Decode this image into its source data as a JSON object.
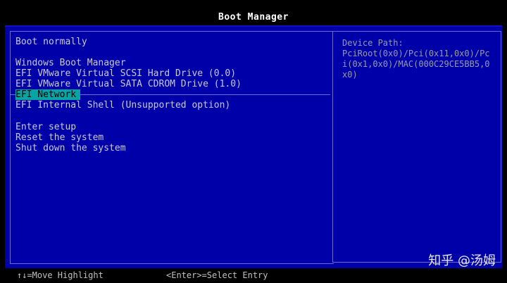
{
  "header": {
    "title": "Boot Manager"
  },
  "menu": {
    "items": [
      {
        "label": "Boot normally"
      },
      {
        "label": "Windows Boot Manager"
      },
      {
        "label": "EFI VMware Virtual SCSI Hard Drive (0.0)"
      },
      {
        "label": "EFI VMware Virtual SATA CDROM Drive (1.0)"
      },
      {
        "label": "EFI Network",
        "selected": true
      },
      {
        "label": "EFI Internal Shell (Unsupported option)"
      },
      {
        "label": "Enter setup"
      },
      {
        "label": "Reset the system"
      },
      {
        "label": "Shut down the system"
      }
    ]
  },
  "info": {
    "label": "Device Path:",
    "value": "PciRoot(0x0)/Pci(0x11,0x0)/Pci(0x1,0x0)/MAC(000C29CE5BB5,0x0)"
  },
  "footer": {
    "move_hint": "↑↓=Move Highlight",
    "select_hint": "<Enter>=Select Entry"
  },
  "watermark": {
    "text": "知乎 @汤姆"
  },
  "colors": {
    "panel_bg": "#0000a8",
    "highlight_bg": "#0aa3a3",
    "text": "#c9c9d6"
  }
}
